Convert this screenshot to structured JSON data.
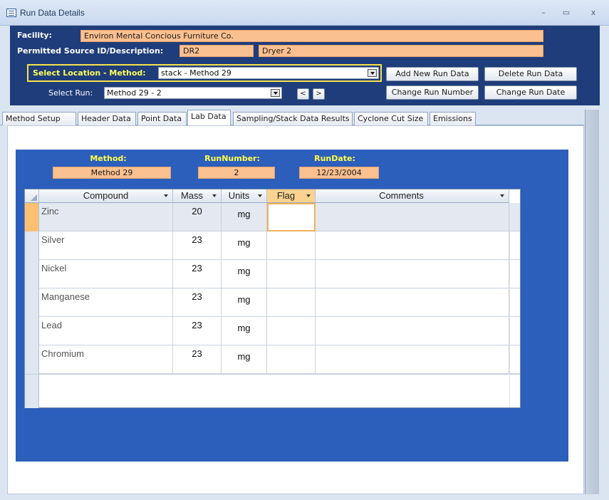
{
  "window": {
    "title": "Run Data Details",
    "controls": {
      "minimize": "–",
      "maximize": "▭",
      "close": "x"
    }
  },
  "header": {
    "facility_label": "Facility:",
    "facility_value": "Environ Mental Concious Furniture Co.",
    "source_label": "Permitted Source ID/Description:",
    "source_id": "DR2",
    "source_description": "Dryer 2",
    "location_label": "Select Location - Method:",
    "location_value": "stack - Method 29",
    "run_label": "Select Run:",
    "run_value": "Method 29 - 2",
    "prev_label": "<",
    "next_label": ">",
    "buttons": {
      "add": "Add New Run Data",
      "delete": "Delete Run Data",
      "change_number": "Change Run Number",
      "change_date": "Change Run Date"
    }
  },
  "tabs": [
    {
      "label": "Method Setup"
    },
    {
      "label": "Header Data"
    },
    {
      "label": "Point Data"
    },
    {
      "label": "Lab Data"
    },
    {
      "label": "Sampling/Stack Data Results"
    },
    {
      "label": "Cyclone Cut Size"
    },
    {
      "label": "Emissions"
    }
  ],
  "active_tab": "Lab Data",
  "lab": {
    "method_label": "Method:",
    "method_value": "Method 29",
    "run_number_label": "RunNumber:",
    "run_number_value": "2",
    "run_date_label": "RunDate:",
    "run_date_value": "12/23/2004",
    "columns": [
      "Compound",
      "Mass",
      "Units",
      "Flag",
      "Comments"
    ],
    "rows": [
      {
        "compound": "Zinc",
        "mass": "20",
        "units": "mg",
        "flag": "",
        "comments": ""
      },
      {
        "compound": "Silver",
        "mass": "23",
        "units": "mg",
        "flag": "",
        "comments": ""
      },
      {
        "compound": "Nickel",
        "mass": "23",
        "units": "mg",
        "flag": "",
        "comments": ""
      },
      {
        "compound": "Manganese",
        "mass": "23",
        "units": "mg",
        "flag": "",
        "comments": ""
      },
      {
        "compound": "Lead",
        "mass": "23",
        "units": "mg",
        "flag": "",
        "comments": ""
      },
      {
        "compound": "Chromium",
        "mass": "23",
        "units": "mg",
        "flag": "",
        "comments": ""
      }
    ]
  },
  "colors": {
    "header_bg": "#1f3d7a",
    "panel_bg": "#2c5ebb",
    "field_bg": "#fbc08f",
    "accent_yellow": "#ffff47"
  }
}
